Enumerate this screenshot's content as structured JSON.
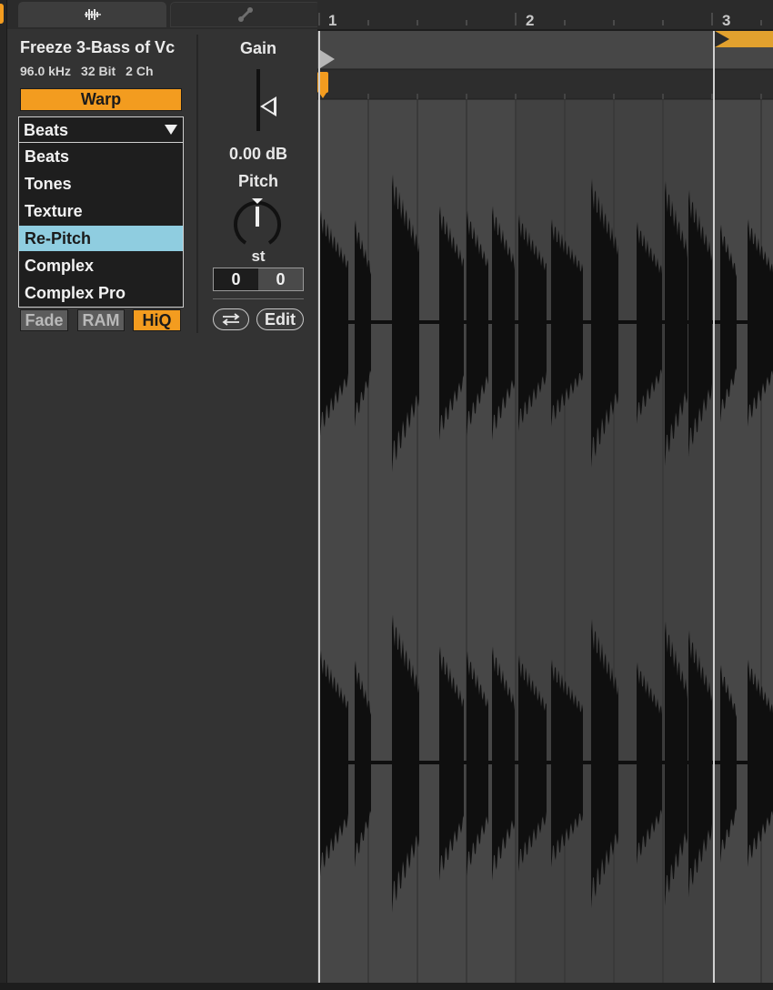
{
  "header": {
    "tabs": [
      {
        "icon": "sample-waveform-icon",
        "active": true
      },
      {
        "icon": "envelope-icon",
        "active": false
      }
    ]
  },
  "sample": {
    "name": "Freeze 3-Bass of Vc",
    "sample_rate": "96.0 kHz",
    "bit_depth": "32 Bit",
    "channels": "2 Ch",
    "warp_label": "Warp",
    "warp_mode": "Beats",
    "warp_modes": [
      "Beats",
      "Tones",
      "Texture",
      "Re-Pitch",
      "Complex",
      "Complex Pro"
    ],
    "highlighted_mode": "Re-Pitch",
    "fade_label": "Fade",
    "ram_label": "RAM",
    "hiq_label": "HiQ"
  },
  "gain": {
    "label": "Gain",
    "value": "0.00 dB"
  },
  "pitch": {
    "label": "Pitch",
    "unit": "st",
    "semitones": "0",
    "detune": "0",
    "edit_label": "Edit"
  },
  "timeline": {
    "bars": [
      "1",
      "2",
      "3"
    ]
  },
  "colors": {
    "accent": "#f39c1f",
    "selection": "#8fcde0",
    "waveform": "#0f0f0f",
    "background": "#333333"
  }
}
